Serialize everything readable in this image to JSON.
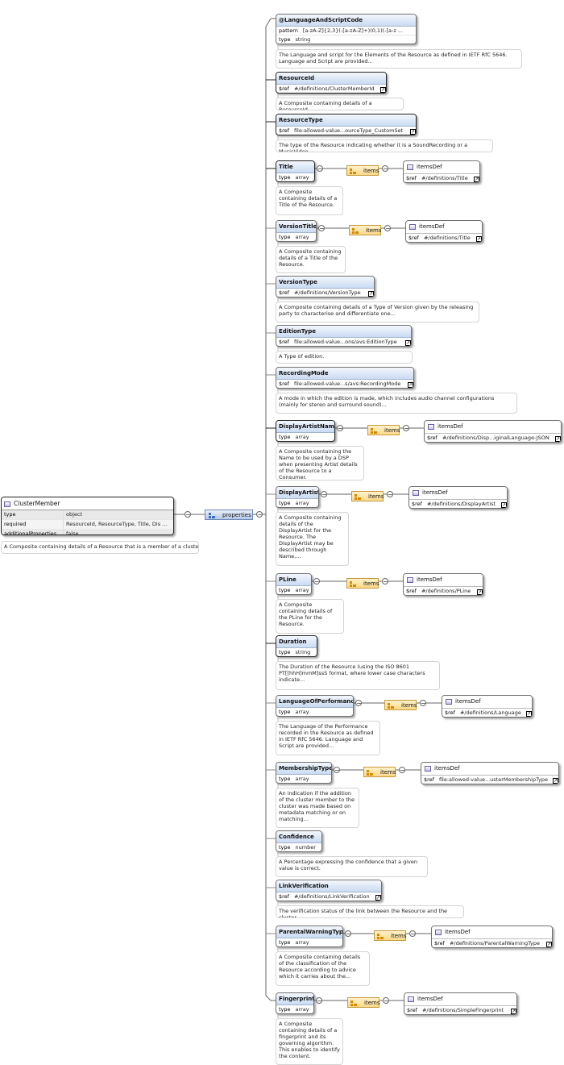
{
  "root": {
    "title": "ClusterMember",
    "fields": [
      {
        "k": "type",
        "v": "object"
      },
      {
        "k": "required",
        "v": "ResourceId, ResourceType, Title, Dis ..."
      },
      {
        "k": "additionalProperties",
        "v": "false"
      }
    ],
    "description": "A Composite containing details of a Resource that is a member of a cluster."
  },
  "properties_label": "properties",
  "toggle_symbol": "−",
  "ref_corner_symbol": "↗",
  "items_label": "items",
  "itemsdef_label": "itemsDef",
  "nodes": [
    {
      "title": "@LanguageAndScriptCode",
      "required": false,
      "fields": [
        {
          "k": "pattern",
          "v": "[a-zA-Z]{2,3}(-[a-zA-Z]+)(0,1)(-[a-z ..."
        },
        {
          "k": "type",
          "v": "string"
        }
      ],
      "description": "The Language and script for the Elements of the Resource as defined in IETF RfC 5646. Language and Script are provided..."
    },
    {
      "title": "ResourceId",
      "required": true,
      "fields": [
        {
          "k": "$ref",
          "v": "#/definitions/ClusterMemberId"
        }
      ],
      "ref": true,
      "description": "A Composite containing details of a ResourceId."
    },
    {
      "title": "ResourceType",
      "required": true,
      "fields": [
        {
          "k": "$ref",
          "v": "file:allowed-value...ourceType_CustomSet"
        }
      ],
      "ref": true,
      "description": "The type of the Resource indicating whether it is a SoundRecording or a MusicVideo."
    },
    {
      "title": "Title",
      "required": true,
      "fields": [
        {
          "k": "type",
          "v": "array"
        }
      ],
      "items": {
        "ref": "#/definitions/Title"
      },
      "description": "A Composite containing details of a Title of the Resource."
    },
    {
      "title": "VersionTitle",
      "required": false,
      "fields": [
        {
          "k": "type",
          "v": "array"
        }
      ],
      "items": {
        "ref": "#/definitions/Title"
      },
      "description": "A Composite containing details of a Title of the Resource."
    },
    {
      "title": "VersionType",
      "required": false,
      "fields": [
        {
          "k": "$ref",
          "v": "#/definitions/VersionType"
        }
      ],
      "ref": true,
      "description": "A Composite containing details of a Type of Version given by the releasing party to characterise and differentiate one..."
    },
    {
      "title": "EditionType",
      "required": false,
      "fields": [
        {
          "k": "$ref",
          "v": "file:allowed-value...ons/avs:EditionType"
        }
      ],
      "ref": true,
      "description": "A Type of edition."
    },
    {
      "title": "RecordingMode",
      "required": false,
      "fields": [
        {
          "k": "$ref",
          "v": "file:allowed-value...s/avs:RecordingMode"
        }
      ],
      "ref": true,
      "description": "A mode in which the edition is made, which includes audio channel configurations (mainly for stereo and surround sound)..."
    },
    {
      "title": "DisplayArtistName",
      "required": true,
      "fields": [
        {
          "k": "type",
          "v": "array"
        }
      ],
      "items": {
        "ref": "#/definitions/Disp...iginalLanguage-JSON"
      },
      "description": "A Composite containing the Name to be used by a DSP when presenting Artist details of the Resource to a Consumer."
    },
    {
      "title": "DisplayArtist",
      "required": false,
      "fields": [
        {
          "k": "type",
          "v": "array"
        }
      ],
      "items": {
        "ref": "#/definitions/DisplayArtist"
      },
      "description": "A Composite containing details of the DisplayArtist for the Resource. The DisplayArtist may be described through Name,..."
    },
    {
      "title": "PLine",
      "required": false,
      "fields": [
        {
          "k": "type",
          "v": "array"
        }
      ],
      "items": {
        "ref": "#/definitions/PLine"
      },
      "description": "A Composite containing details of the PLine for the Resource."
    },
    {
      "title": "Duration",
      "required": true,
      "fields": [
        {
          "k": "type",
          "v": "string"
        }
      ],
      "description": "The Duration of the Resource (using the ISO 8601 PT[[hhH]mmM]ssS format, where lower case characters indicate..."
    },
    {
      "title": "LanguageOfPerformance",
      "required": false,
      "fields": [
        {
          "k": "type",
          "v": "array"
        }
      ],
      "items": {
        "ref": "#/definitions/Language"
      },
      "description": "The Language of the Performance recorded in the Resource as defined in IETF RfC 5646. Language and Script are provided..."
    },
    {
      "title": "MembershipType",
      "required": false,
      "fields": [
        {
          "k": "type",
          "v": "array"
        }
      ],
      "items": {
        "ref": "file:allowed-value...usterMembershipType"
      },
      "description": "An indication if the addition of the cluster member to the cluster was made based on metadata matching or on matching..."
    },
    {
      "title": "Confidence",
      "required": false,
      "fields": [
        {
          "k": "type",
          "v": "number"
        }
      ],
      "description": "A Percentage expressing the confidence that a given value is correct."
    },
    {
      "title": "LinkVerification",
      "required": false,
      "fields": [
        {
          "k": "$ref",
          "v": "#/definitions/LinkVerification"
        }
      ],
      "ref": true,
      "description": "The verification status of the link between the Resource and the cluster."
    },
    {
      "title": "ParentalWarningType",
      "required": false,
      "fields": [
        {
          "k": "type",
          "v": "array"
        }
      ],
      "items": {
        "ref": "#/definitions/ParentalWarningType"
      },
      "description": "A Composite containing details of the classification of the Resource according to advice which it carries about the..."
    },
    {
      "title": "Fingerprint",
      "required": false,
      "fields": [
        {
          "k": "type",
          "v": "array"
        }
      ],
      "items": {
        "ref": "#/definitions/SimpleFingerprint"
      },
      "description": "A Composite containing details of a fingerprint and its governing algorithm. This enables to identify the content."
    }
  ]
}
